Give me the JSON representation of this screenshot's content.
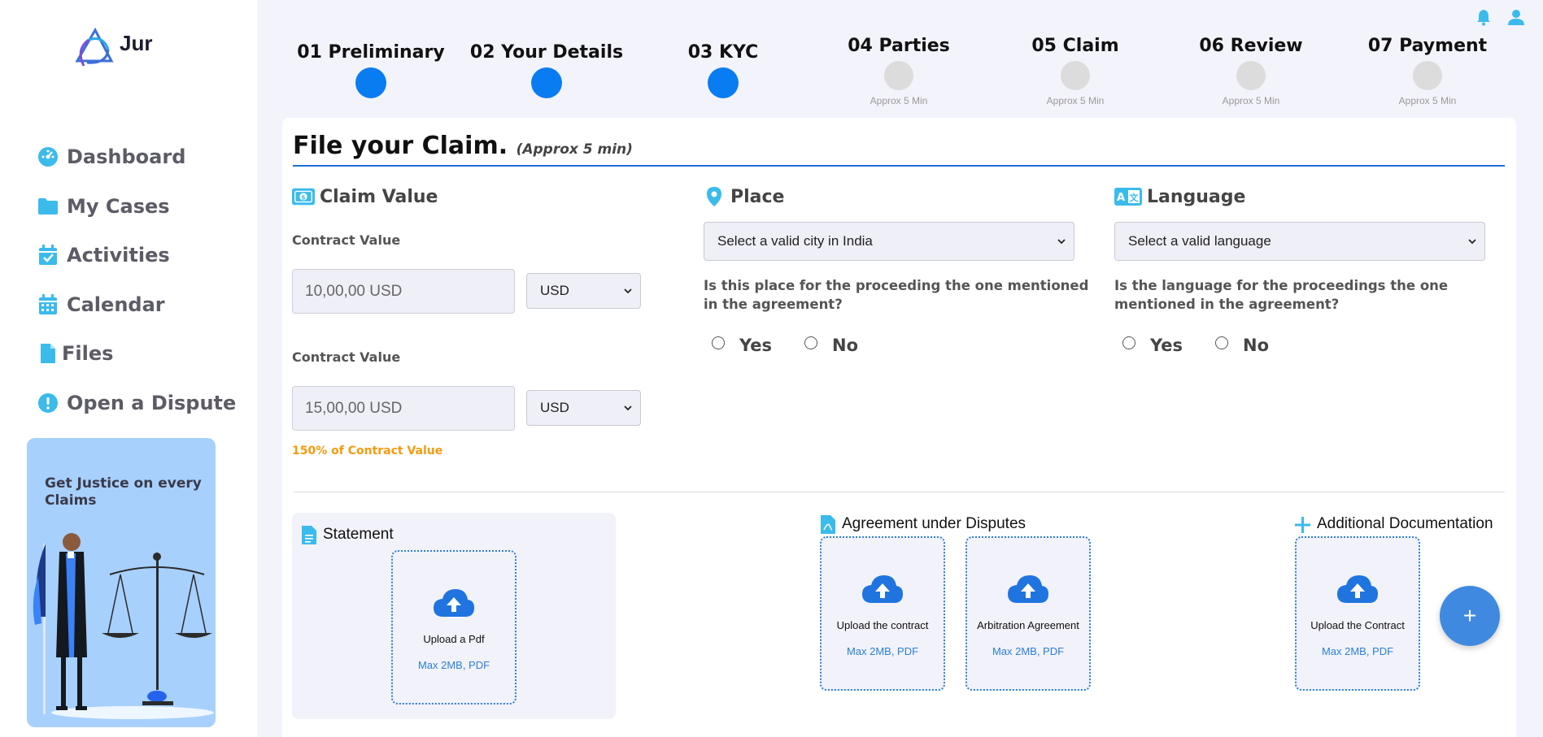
{
  "brand": {
    "name": "Jur"
  },
  "sidebar": {
    "items": [
      {
        "label": "Dashboard",
        "icon": "dashboard-icon"
      },
      {
        "label": "My Cases",
        "icon": "folder-icon"
      },
      {
        "label": "Activities",
        "icon": "calendar-check-icon"
      },
      {
        "label": "Calendar",
        "icon": "calendar-icon"
      },
      {
        "label": "Files",
        "icon": "file-icon"
      },
      {
        "label": "Open a Dispute",
        "icon": "alert-icon"
      }
    ],
    "promo": {
      "text": "Get Justice on every Claims"
    }
  },
  "steps": [
    {
      "label": "01 Preliminary",
      "status": "done",
      "sub": ""
    },
    {
      "label": "02 Your Details",
      "status": "done",
      "sub": ""
    },
    {
      "label": "03 KYC",
      "status": "done",
      "sub": ""
    },
    {
      "label": "04 Parties",
      "status": "todo",
      "sub": "Approx 5 Min"
    },
    {
      "label": "05 Claim",
      "status": "todo",
      "sub": "Approx 5 Min"
    },
    {
      "label": "06 Review",
      "status": "todo",
      "sub": "Approx 5 Min"
    },
    {
      "label": "07 Payment",
      "status": "todo",
      "sub": "Approx 5 Min"
    }
  ],
  "form": {
    "title": "File your Claim.",
    "title_note": "(Approx 5 min)",
    "claim_value": {
      "heading": "Claim Value",
      "contract_label_1": "Contract Value",
      "contract_value_1": "10,00,00 USD",
      "currency_1": "USD",
      "contract_label_2": "Contract Value",
      "contract_value_2": "15,00,00 USD",
      "currency_2": "USD",
      "note": "150% of Contract Value"
    },
    "place": {
      "heading": "Place",
      "select": "Select a valid city in India",
      "question": "Is this place for the proceeding the one mentioned in the agreement?",
      "yes": "Yes",
      "no": "No"
    },
    "language": {
      "heading": "Language",
      "select": "Select a valid language",
      "question": "Is the language for the proceedings the one mentioned in the agreement?",
      "yes": "Yes",
      "no": "No"
    }
  },
  "documents": {
    "statement": {
      "heading": "Statement",
      "upload_title": "Upload a Pdf",
      "upload_sub": "Max 2MB, PDF"
    },
    "agreement": {
      "heading": "Agreement under Disputes",
      "upload1_title": "Upload the contract",
      "upload1_sub": "Max 2MB, PDF",
      "upload2_title": "Arbitration Agreement",
      "upload2_sub": "Max 2MB, PDF"
    },
    "additional": {
      "heading": "Additional Documentation",
      "upload_title": "Upload the Contract",
      "upload_sub": "Max 2MB, PDF"
    },
    "fab_label": "+"
  },
  "colors": {
    "accent": "#0a7cf2",
    "icon": "#3bbbeb",
    "warning": "#f49b10"
  }
}
